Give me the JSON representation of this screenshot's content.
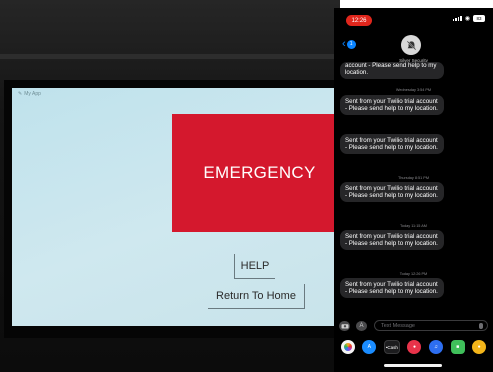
{
  "tablet": {
    "app_title": "My App",
    "emergency_label": "EMERGENCY",
    "help_label": "HELP",
    "home_label": "Return To Home"
  },
  "phone": {
    "status": {
      "time": "12:26",
      "battery": "83"
    },
    "header": {
      "back_count": "1",
      "contact": "Silver Security"
    },
    "messages": [
      {
        "kind": "partial",
        "text": "account - Please send help to my location."
      },
      {
        "kind": "timestamp",
        "text": "Wednesday 3:54 PM"
      },
      {
        "kind": "bubble",
        "text": "Sent from your Twilio trial account - Please send help to my location."
      },
      {
        "kind": "bubble",
        "text": "Sent from your Twilio trial account - Please send help to my location."
      },
      {
        "kind": "timestamp",
        "text": "Thursday 8:51 PM"
      },
      {
        "kind": "bubble",
        "text": "Sent from your Twilio trial account - Please send help to my location."
      },
      {
        "kind": "timestamp",
        "text": "Today 11:15 AM"
      },
      {
        "kind": "bubble",
        "text": "Sent from your Twilio trial account - Please send help to my location."
      },
      {
        "kind": "timestamp",
        "text": "Today 12:26 PM"
      },
      {
        "kind": "bubble",
        "text": "Sent from your Twilio trial account - Please send help to my location."
      }
    ],
    "input_placeholder": "Text Message",
    "cash_label": "•Cash",
    "app_icons": [
      "photos-icon",
      "app-store-icon",
      "apple-cash-icon",
      "search-images-icon",
      "music-recognition-icon",
      "sticker-icon",
      "game-icon"
    ],
    "colors": {
      "accent": "#0a84ff",
      "bubble": "#262628",
      "emergency": "#d4182d",
      "time_pill": "#e0261c"
    }
  }
}
